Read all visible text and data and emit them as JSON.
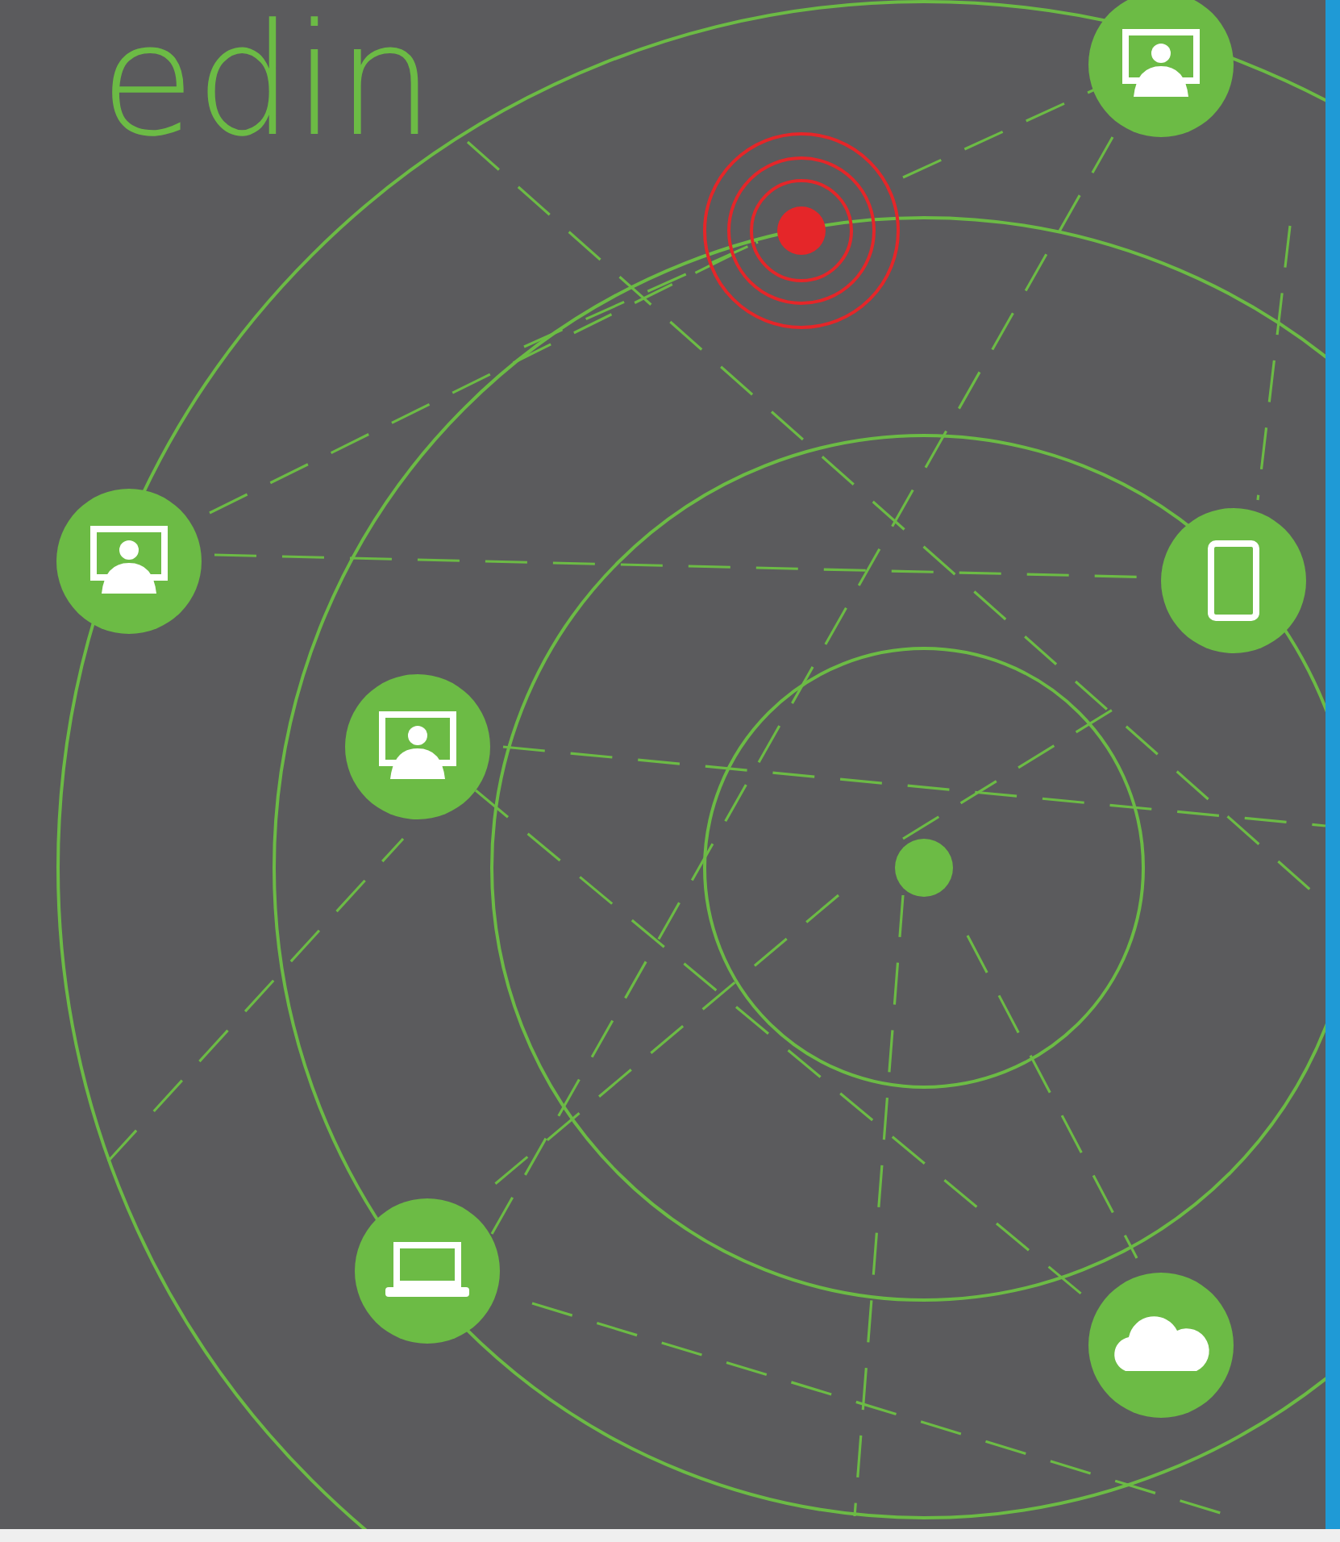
{
  "heading": {
    "text": "edin"
  }
}
